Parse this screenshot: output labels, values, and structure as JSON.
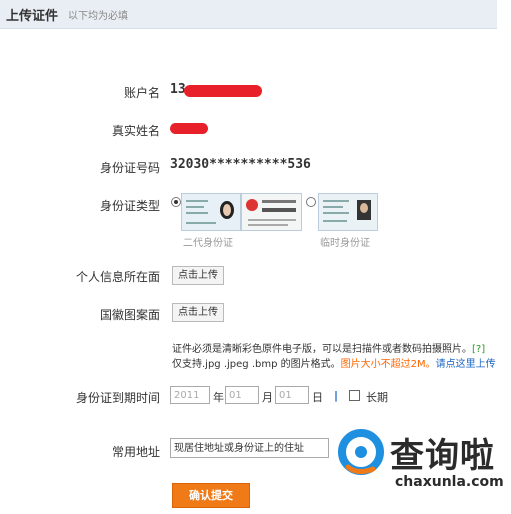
{
  "header": {
    "title": "上传证件",
    "note": "以下均为必填"
  },
  "form": {
    "account": {
      "label": "账户名",
      "value": "13"
    },
    "real_name": {
      "label": "真实姓名",
      "value": ""
    },
    "id_number": {
      "label": "身份证号码",
      "value": "32030**********536"
    },
    "id_type": {
      "label": "身份证类型",
      "option_1": "二代身份证",
      "option_2": "临时身份证",
      "selected": "二代身份证"
    },
    "personal_info_side": {
      "label": "个人信息所在面",
      "button": "点击上传"
    },
    "emblem_side": {
      "label": "国徽图案面",
      "button": "点击上传"
    },
    "help": {
      "line1": "证件必须是清晰彩色原件电子版，可以是扫描件或者数码拍摄照片。",
      "q": "[?]",
      "line2_prefix": "仅支持.jpg .jpeg .bmp 的图片格式。",
      "size_limit": "图片大小不超过2M。",
      "upload_link": "请点这里上传"
    },
    "expiry": {
      "label": "身份证到期时间",
      "year_placeholder": "2011",
      "year_unit": "年",
      "month_placeholder": "01",
      "month_unit": "月",
      "day_placeholder": "01",
      "day_unit": "日",
      "separator": "|",
      "long_term": "长期"
    },
    "address": {
      "label": "常用地址",
      "value": "现居住地址或身份证上的住址"
    },
    "submit": "确认提交"
  },
  "watermark": {
    "name": "查询啦",
    "url": "chaxunla.com"
  },
  "colors": {
    "accent": "#f07a18",
    "link": "#1a66c4",
    "redaction": "#e8202a"
  }
}
